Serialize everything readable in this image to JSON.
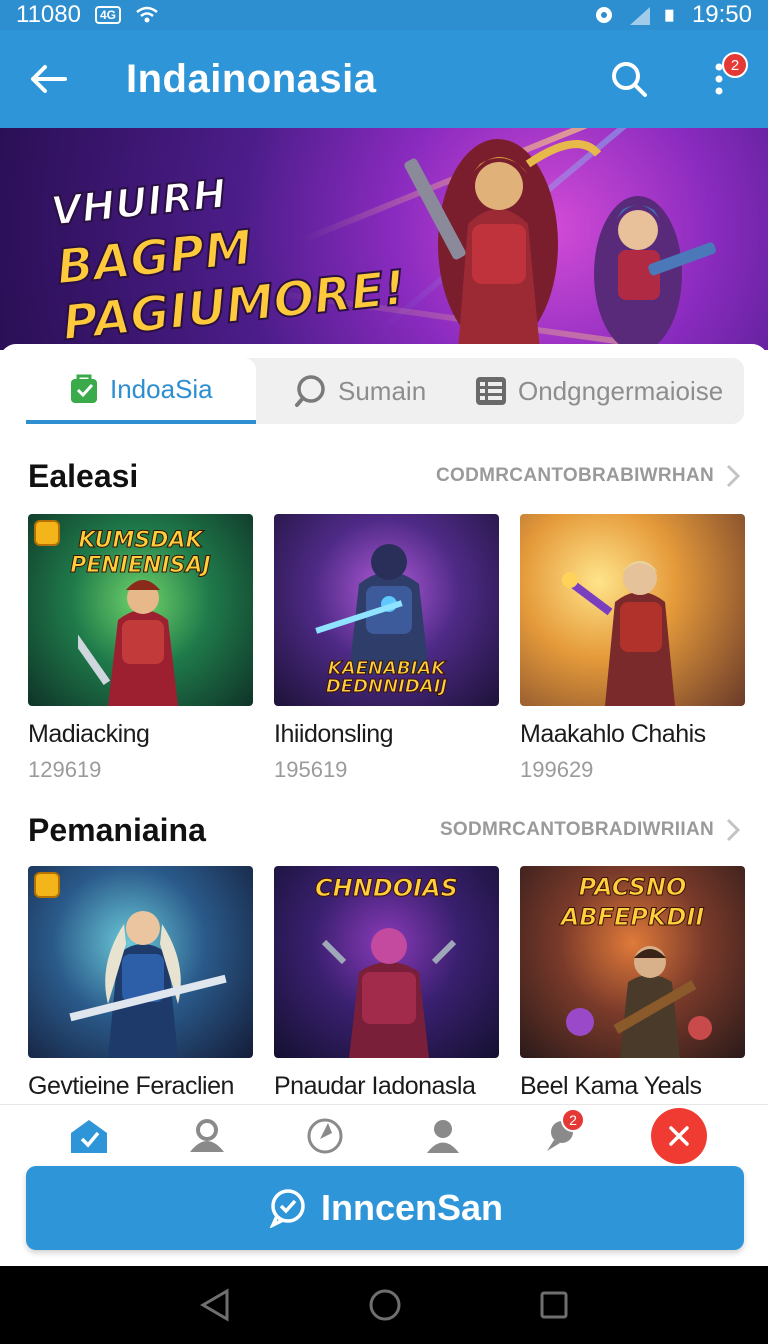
{
  "status_bar": {
    "time_left": "11080",
    "chip": "4G",
    "time_right": "19:50"
  },
  "app_bar": {
    "title": "Indainonasia",
    "more_badge": "2"
  },
  "hero": {
    "line1": "VHUIRH",
    "line2": "BAGPM",
    "line3": "PAGIUMORE!"
  },
  "tabs": [
    {
      "label": "IndoaSia",
      "icon": "bag-icon"
    },
    {
      "label": "Sumain",
      "icon": "search-icon"
    },
    {
      "label": "Ondgngermaioise",
      "icon": "list-icon"
    }
  ],
  "sections": [
    {
      "title": "Ealeasi",
      "link": "CODMRCANTOBRABIWRHAN",
      "cards": [
        {
          "name": "Madiacking",
          "count": "129619",
          "caption": "KUMSDAK PENIENISAJ"
        },
        {
          "name": "Ihiidonsling",
          "count": "195619",
          "caption": "KAENABIAK DEDNNIDAIJ"
        },
        {
          "name": "Maakahlo Chahis",
          "count": "199629",
          "caption": ""
        }
      ]
    },
    {
      "title": "Pemaniaina",
      "link": "SODMRCANTOBRADIWRIIAN",
      "cards": [
        {
          "name": "Gevtieine Feraclien",
          "count": "",
          "caption": ""
        },
        {
          "name": "Pnaudar Iadonasla",
          "count": "",
          "caption": "CHNDOIAS"
        },
        {
          "name": "Beel Kama Yeals",
          "count": "",
          "caption": "PACSNO ABFEPKDII"
        }
      ]
    }
  ],
  "bottom_nav": {
    "badge": "2"
  },
  "cta": {
    "label": "InncenSan"
  },
  "colors": {
    "primary": "#2e95d8",
    "accent_red": "#ef3b32"
  }
}
